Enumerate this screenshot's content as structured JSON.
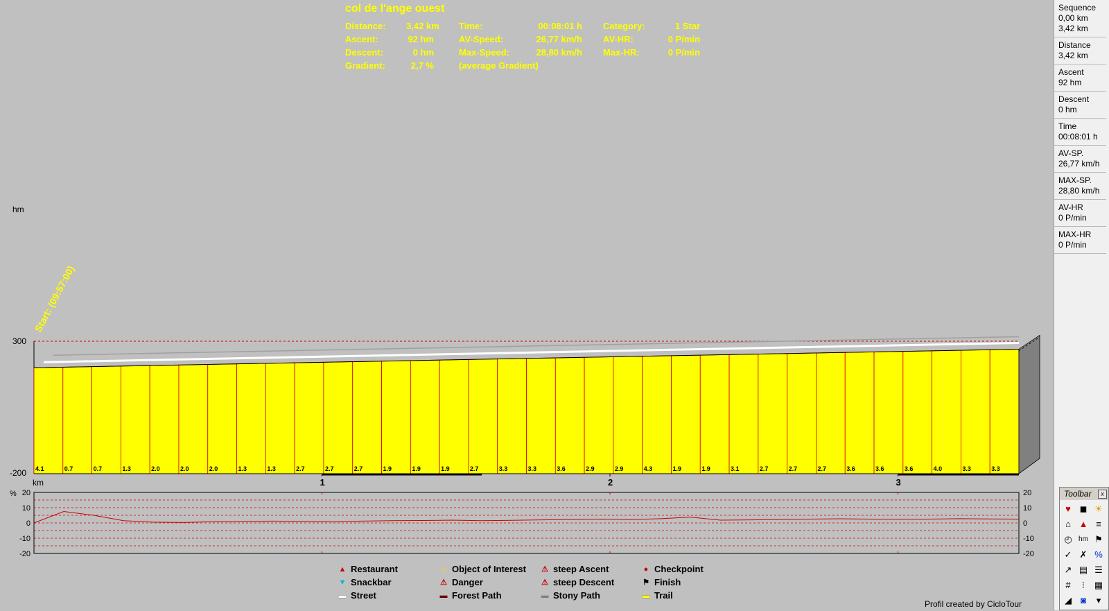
{
  "summary": {
    "title": "col de l'ange ouest",
    "rows": [
      [
        "Distance:",
        "3,42 km",
        "Time:",
        "00:08:01 h",
        "Category:",
        "1 Star"
      ],
      [
        "Ascent:",
        "92 hm",
        "AV-Speed:",
        "26,77 km/h",
        "AV-HR:",
        "0 P/min"
      ],
      [
        "Descent:",
        "0 hm",
        "Max-Speed:",
        "28,80 km/h",
        "Max-HR:",
        "0 P/min"
      ],
      [
        "Gradient:",
        "2,7 %",
        "(average Gradient)",
        "",
        "",
        ""
      ]
    ]
  },
  "sidebar": [
    {
      "label": "Sequence",
      "values": [
        "0,00 km",
        "3,42 km"
      ]
    },
    {
      "label": "Distance",
      "values": [
        "3,42 km"
      ]
    },
    {
      "label": "Ascent",
      "values": [
        "92 hm"
      ]
    },
    {
      "label": "Descent",
      "values": [
        "0 hm"
      ]
    },
    {
      "label": "Time",
      "values": [
        "00:08:01 h"
      ]
    },
    {
      "label": "AV-SP.",
      "values": [
        "26,77 km/h"
      ]
    },
    {
      "label": "MAX-SP.",
      "values": [
        "28,80 km/h"
      ]
    },
    {
      "label": "AV-HR",
      "values": [
        "0 P/min"
      ]
    },
    {
      "label": "MAX-HR",
      "values": [
        "0 P/min"
      ]
    }
  ],
  "profile": {
    "y_unit": "hm",
    "y_ticks": [
      "300",
      "-200"
    ],
    "x_unit": "km",
    "x_ticks": [
      "1",
      "2",
      "3"
    ],
    "start_label": "Start: (09:57:00)",
    "total_km": 3.42,
    "elevation_start_hm": 200,
    "elevation_end_hm": 270,
    "segment_gradients": [
      "4.1",
      "0.7",
      "0.7",
      "1.3",
      "2.0",
      "2.0",
      "2.0",
      "1.3",
      "1.3",
      "2.7",
      "2.7",
      "2.7",
      "1.9",
      "1.9",
      "1.9",
      "2.7",
      "3.3",
      "3.3",
      "3.6",
      "2.9",
      "2.9",
      "4.3",
      "1.9",
      "1.9",
      "3.1",
      "2.7",
      "2.7",
      "2.7",
      "3.6",
      "3.6",
      "3.6",
      "4.0",
      "3.3",
      "3.3"
    ],
    "fill_color": "#ffff00",
    "colors": {
      "grid": "#cc0000",
      "outline": "#000000",
      "side": "#808080"
    }
  },
  "gradient_chart": {
    "unit": "%",
    "ticks": [
      "20",
      "10",
      "0",
      "-10",
      "-20"
    ],
    "series": [
      0,
      7.5,
      5,
      1.5,
      0.5,
      0.3,
      0.8,
      1,
      1.2,
      1,
      0.8,
      1.2,
      1.5,
      1.6,
      1.8,
      1.5,
      1.7,
      2,
      2.2,
      2.5,
      2.2,
      2.8,
      3.8,
      1.8,
      2,
      2.2,
      2.5,
      2.7,
      2.5,
      2.4,
      2.5,
      2.8,
      2.6,
      2.5
    ]
  },
  "legend": [
    {
      "icon": "restaurant-icon",
      "label": "Restaurant",
      "color": "#cc0000"
    },
    {
      "icon": "object-of-interest-icon",
      "label": "Object of Interest",
      "color": "#ffd700"
    },
    {
      "icon": "steep-ascent-icon",
      "label": "steep Ascent",
      "color": "#cc0000"
    },
    {
      "icon": "checkpoint-icon",
      "label": "Checkpoint",
      "color": "#cc0000"
    },
    {
      "icon": "snackbar-icon",
      "label": "Snackbar",
      "color": "#00bcd4"
    },
    {
      "icon": "danger-icon",
      "label": "Danger",
      "color": "#cc0000"
    },
    {
      "icon": "steep-descent-icon",
      "label": "steep Descent",
      "color": "#cc0000"
    },
    {
      "icon": "finish-icon",
      "label": "Finish",
      "color": "#000000"
    },
    {
      "icon": "street-icon",
      "label": "Street",
      "color": "#ffffff"
    },
    {
      "icon": "forest-path-icon",
      "label": "Forest Path",
      "color": "#660000"
    },
    {
      "icon": "stony-path-icon",
      "label": "Stony Path",
      "color": "#808080"
    },
    {
      "icon": "trail-icon",
      "label": "Trail",
      "color": "#ffff00"
    }
  ],
  "credit": "Profil created by CicloTour",
  "toolbar": {
    "title": "Toolbar",
    "buttons": [
      {
        "name": "heart-icon",
        "glyph": "♥"
      },
      {
        "name": "camera-icon",
        "glyph": "◼"
      },
      {
        "name": "sun-icon",
        "glyph": "☀"
      },
      {
        "name": "shirt-icon",
        "glyph": "⌂"
      },
      {
        "name": "warning-icon",
        "glyph": "▲"
      },
      {
        "name": "bars-icon",
        "glyph": "≡"
      },
      {
        "name": "clock-icon",
        "glyph": "◴"
      },
      {
        "name": "hm-icon",
        "glyph": "hm"
      },
      {
        "name": "flag-icon",
        "glyph": "⚑"
      },
      {
        "name": "abc-check-icon",
        "glyph": "✓"
      },
      {
        "name": "abc-zoom-icon",
        "glyph": "✗"
      },
      {
        "name": "percent-icon",
        "glyph": "%"
      },
      {
        "name": "arrow-icon",
        "glyph": "↗"
      },
      {
        "name": "road-icon",
        "glyph": "▤"
      },
      {
        "name": "list-icon",
        "glyph": "☰"
      },
      {
        "name": "grid-icon",
        "glyph": "#"
      },
      {
        "name": "table-icon",
        "glyph": "⁝"
      },
      {
        "name": "chart-icon",
        "glyph": "▦"
      },
      {
        "name": "profile-icon",
        "glyph": "◢"
      },
      {
        "name": "bike-icon",
        "glyph": "◙"
      },
      {
        "name": "more-icon",
        "glyph": "▾"
      }
    ]
  }
}
